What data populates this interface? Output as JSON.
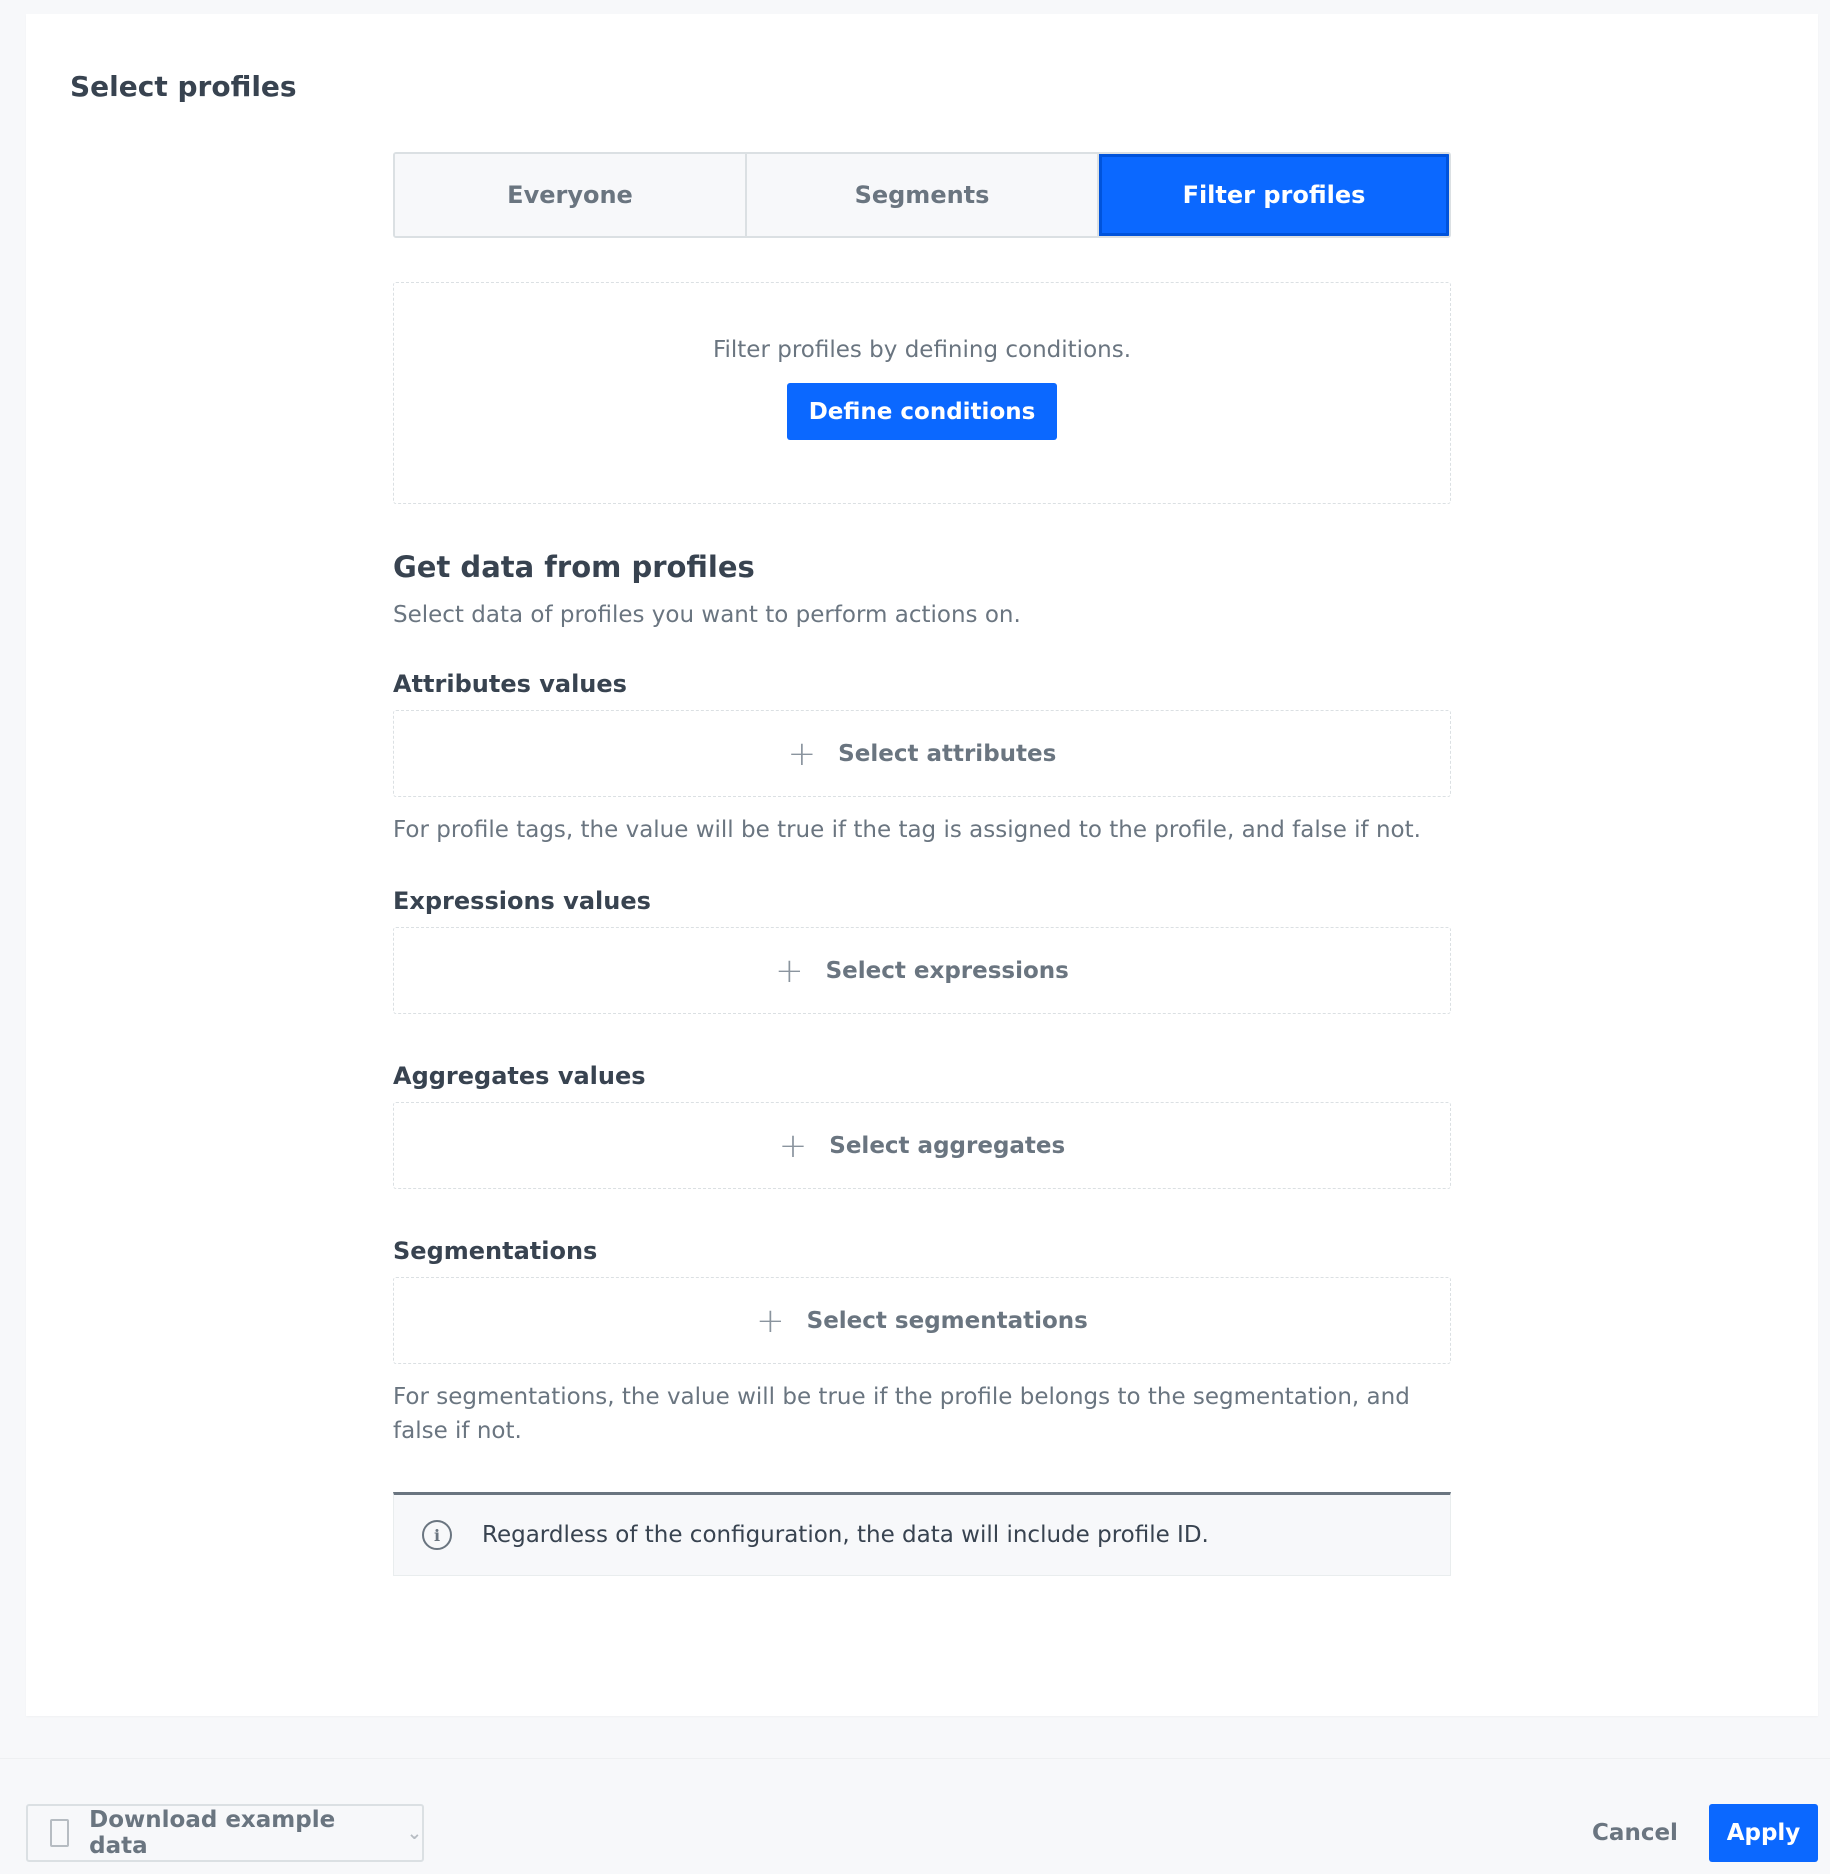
{
  "panel": {
    "title": "Select profiles"
  },
  "tabs": [
    {
      "label": "Everyone",
      "active": false
    },
    {
      "label": "Segments",
      "active": false
    },
    {
      "label": "Filter profiles",
      "active": true
    }
  ],
  "filter": {
    "description": "Filter profiles by defining conditions.",
    "button_label": "Define conditions"
  },
  "data_section": {
    "heading": "Get data from profiles",
    "description": "Select data of profiles you want to perform actions on.",
    "groups": [
      {
        "label": "Attributes values",
        "select_label": "Select attributes",
        "hint": "For profile tags, the value will be true if the tag is assigned to the profile, and false if not."
      },
      {
        "label": "Expressions values",
        "select_label": "Select expressions"
      },
      {
        "label": "Aggregates values",
        "select_label": "Select aggregates"
      },
      {
        "label": "Segmentations",
        "select_label": "Select segmentations",
        "hint": "For segmentations, the value will be true if the profile belongs to the segmentation, and false if not."
      }
    ],
    "info": "Regardless of the configuration, the data will include profile ID."
  },
  "footer": {
    "download_label": "Download example data",
    "cancel_label": "Cancel",
    "apply_label": "Apply"
  },
  "colors": {
    "accent": "#0b68ff",
    "text": "#384350",
    "muted": "#6a7580"
  },
  "icons": {
    "plus": "plus-icon",
    "info": "info-icon",
    "file": "file-icon",
    "chevron": "chevron-down-icon"
  }
}
